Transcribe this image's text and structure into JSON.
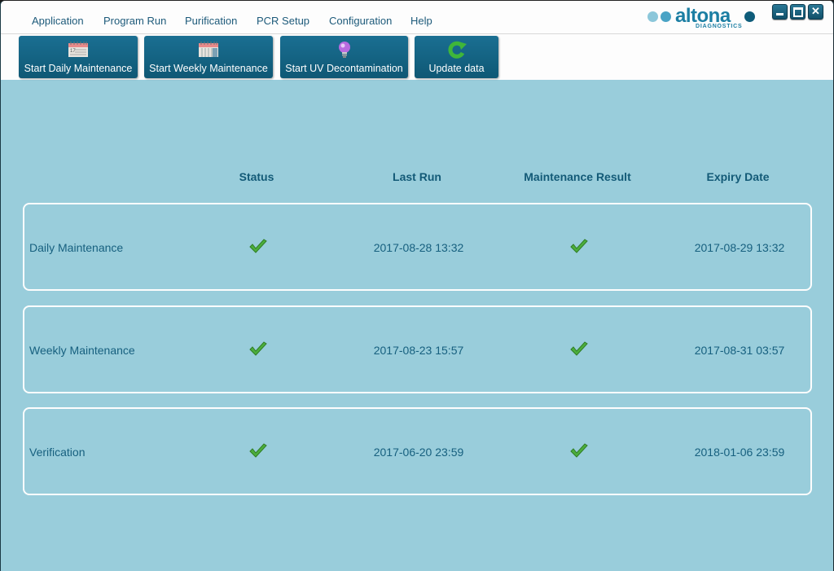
{
  "menu": {
    "items": [
      "Application",
      "Program Run",
      "Purification",
      "PCR Setup",
      "Configuration",
      "Help"
    ]
  },
  "logo": {
    "name": "altona",
    "subtitle": "DIAGNOSTICS"
  },
  "window_controls": {
    "minimize": "minimize-icon",
    "maximize": "maximize-icon",
    "close": "close-icon"
  },
  "toolbar": {
    "buttons": [
      {
        "label": "Start Daily Maintenance",
        "icon": "calendar-daily-icon"
      },
      {
        "label": "Start Weekly Maintenance",
        "icon": "calendar-weekly-icon"
      },
      {
        "label": "Start UV Decontamination",
        "icon": "uv-lightbulb-icon"
      },
      {
        "label": "Update data",
        "icon": "refresh-icon"
      }
    ]
  },
  "table": {
    "headers": [
      "Status",
      "Last Run",
      "Maintenance Result",
      "Expiry Date"
    ],
    "rows": [
      {
        "name": "Daily Maintenance",
        "status": "ok",
        "last_run": "2017-08-28 13:32",
        "result": "ok",
        "expiry": "2017-08-29 13:32"
      },
      {
        "name": "Weekly Maintenance",
        "status": "ok",
        "last_run": "2017-08-23 15:57",
        "result": "ok",
        "expiry": "2017-08-31 03:57"
      },
      {
        "name": "Verification",
        "status": "ok",
        "last_run": "2017-06-20 23:59",
        "result": "ok",
        "expiry": "2018-01-06 23:59"
      }
    ]
  },
  "colors": {
    "background": "#99cddb",
    "button": "#13607f",
    "text": "#17607f",
    "check": "#4cae3c"
  }
}
